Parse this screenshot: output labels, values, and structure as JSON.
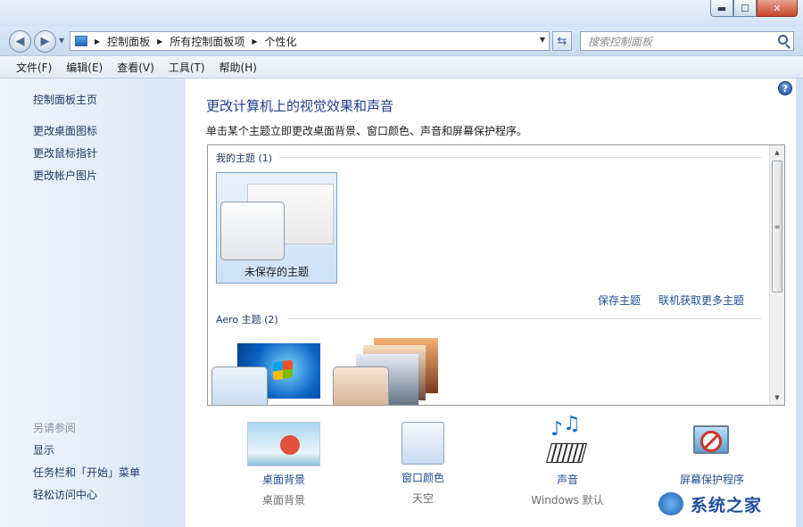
{
  "window": {
    "minimize": "▬",
    "maximize": "☐",
    "close": "✕"
  },
  "address": {
    "crumbs": [
      "控制面板",
      "所有控制面板项",
      "个性化"
    ]
  },
  "search": {
    "placeholder": "搜索控制面板"
  },
  "menu": [
    "文件(F)",
    "编辑(E)",
    "查看(V)",
    "工具(T)",
    "帮助(H)"
  ],
  "sidebar": {
    "items": [
      "控制面板主页",
      "更改桌面图标",
      "更改鼠标指针",
      "更改帐户图片"
    ],
    "see_also_heading": "另请参阅",
    "see_also": [
      "显示",
      "任务栏和「开始」菜单",
      "轻松访问中心"
    ]
  },
  "main": {
    "title": "更改计算机上的视觉效果和声音",
    "description": "单击某个主题立即更改桌面背景、窗口颜色、声音和屏幕保护程序。",
    "my_themes_heading": "我的主题 (1)",
    "unsaved_theme_label": "未保存的主题",
    "save_theme_link": "保存主题",
    "get_more_link": "联机获取更多主题",
    "aero_heading": "Aero 主题 (2)"
  },
  "settings": [
    {
      "label": "桌面背景",
      "value": "桌面背景",
      "icon": "desktop-background-icon"
    },
    {
      "label": "窗口颜色",
      "value": "天空",
      "icon": "window-color-icon"
    },
    {
      "label": "声音",
      "value": "Windows 默认",
      "icon": "sounds-icon"
    },
    {
      "label": "屏幕保护程序",
      "value": "",
      "icon": "screen-saver-icon"
    }
  ],
  "watermark": {
    "text": "系统之家"
  }
}
